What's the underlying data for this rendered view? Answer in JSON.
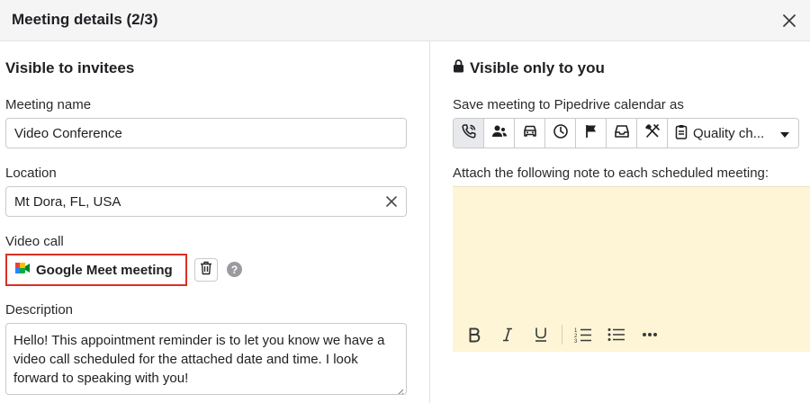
{
  "header": {
    "title": "Meeting details (2/3)",
    "close_icon": "close-icon"
  },
  "left": {
    "section_title": "Visible to invitees",
    "meeting_name": {
      "label": "Meeting name",
      "value": "Video Conference"
    },
    "location": {
      "label": "Location",
      "value": "Mt Dora, FL, USA"
    },
    "video_call": {
      "label": "Video call",
      "provider": "Google Meet meeting",
      "provider_icon": "google-meet-icon"
    },
    "description": {
      "label": "Description",
      "value": "Hello! This appointment reminder is to let you know we have a video call scheduled for the attached date and time. I look forward to speaking with you!"
    }
  },
  "right": {
    "section_title": "Visible only to you",
    "save_as_label": "Save meeting to Pipedrive calendar as",
    "activity_types": [
      {
        "icon": "phone-call-icon",
        "active": true
      },
      {
        "icon": "meeting-people-icon",
        "active": false
      },
      {
        "icon": "car-icon",
        "active": false
      },
      {
        "icon": "clock-icon",
        "active": false
      },
      {
        "icon": "flag-icon",
        "active": false
      },
      {
        "icon": "inbox-icon",
        "active": false
      },
      {
        "icon": "lunch-icon",
        "active": false
      }
    ],
    "selected_type": "Quality ch...",
    "note_label": "Attach the following note to each scheduled meeting:",
    "note_toolbar": [
      "bold-icon",
      "italic-icon",
      "underline-icon",
      "ordered-list-icon",
      "bullet-list-icon",
      "more-icon"
    ]
  },
  "colors": {
    "highlight_border": "#d93025",
    "note_background": "#fdf5d6",
    "header_background": "#f5f5f6"
  }
}
